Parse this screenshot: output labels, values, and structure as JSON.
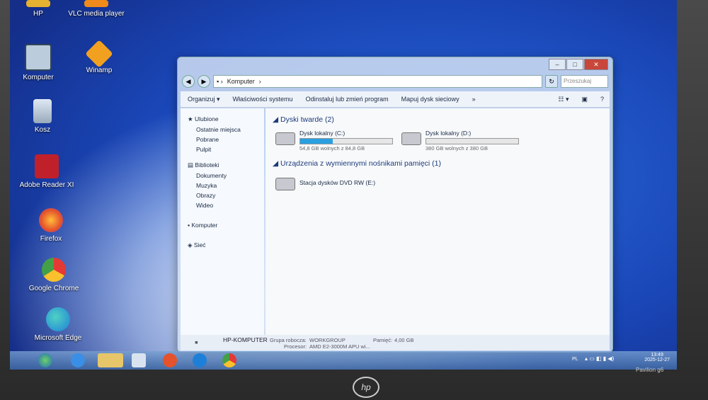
{
  "desktop": {
    "icons": [
      {
        "label": "HP"
      },
      {
        "label": "VLC media player"
      },
      {
        "label": "Komputer"
      },
      {
        "label": "Winamp"
      },
      {
        "label": "Kosz"
      },
      {
        "label": "Adobe Reader XI"
      },
      {
        "label": "Firefox"
      },
      {
        "label": "Google Chrome"
      },
      {
        "label": "Microsoft Edge"
      }
    ]
  },
  "explorer": {
    "address": [
      "Komputer"
    ],
    "search_placeholder": "Przeszukaj",
    "toolbar": [
      "Organizuj ▾",
      "Właściwości systemu",
      "Odinstaluj lub zmień program",
      "Mapuj dysk sieciowy",
      "»"
    ],
    "nav": {
      "favorites": "Ulubione",
      "fav_items": [
        "Ostatnie miejsca",
        "Pobrane",
        "Pulpit"
      ],
      "libraries": "Biblioteki",
      "lib_items": [
        "Dokumenty",
        "Muzyka",
        "Obrazy",
        "Wideo"
      ],
      "computer": "Komputer",
      "network": "Sieć"
    },
    "groups": {
      "hdd": "Dyski twarde (2)",
      "removable": "Urządzenia z wymiennymi nośnikami pamięci (1)"
    },
    "drives": [
      {
        "name": "Dysk lokalny (C:)",
        "free": "54,8 GB wolnych z 84,8 GB",
        "used_fraction": 0.35
      },
      {
        "name": "Dysk lokalny (D:)",
        "free": "380 GB wolnych z 380 GB",
        "used_fraction": 0.0
      }
    ],
    "dvd": "Stacja dysków DVD RW (E:)",
    "details": {
      "computer_name": "HP-KOMPUTER",
      "workgroup_label": "Grupa robocza:",
      "workgroup": "WORKGROUP",
      "memory_label": "Pamięć:",
      "memory": "4,00 GB",
      "cpu_label": "Procesor:",
      "cpu": "AMD E2-3000M APU wi..."
    }
  },
  "taskbar": {
    "lang": "PL",
    "time": "13:49",
    "date": "2025-12-27"
  },
  "laptop": {
    "brand": "hp",
    "model": "Pavilion g6"
  }
}
